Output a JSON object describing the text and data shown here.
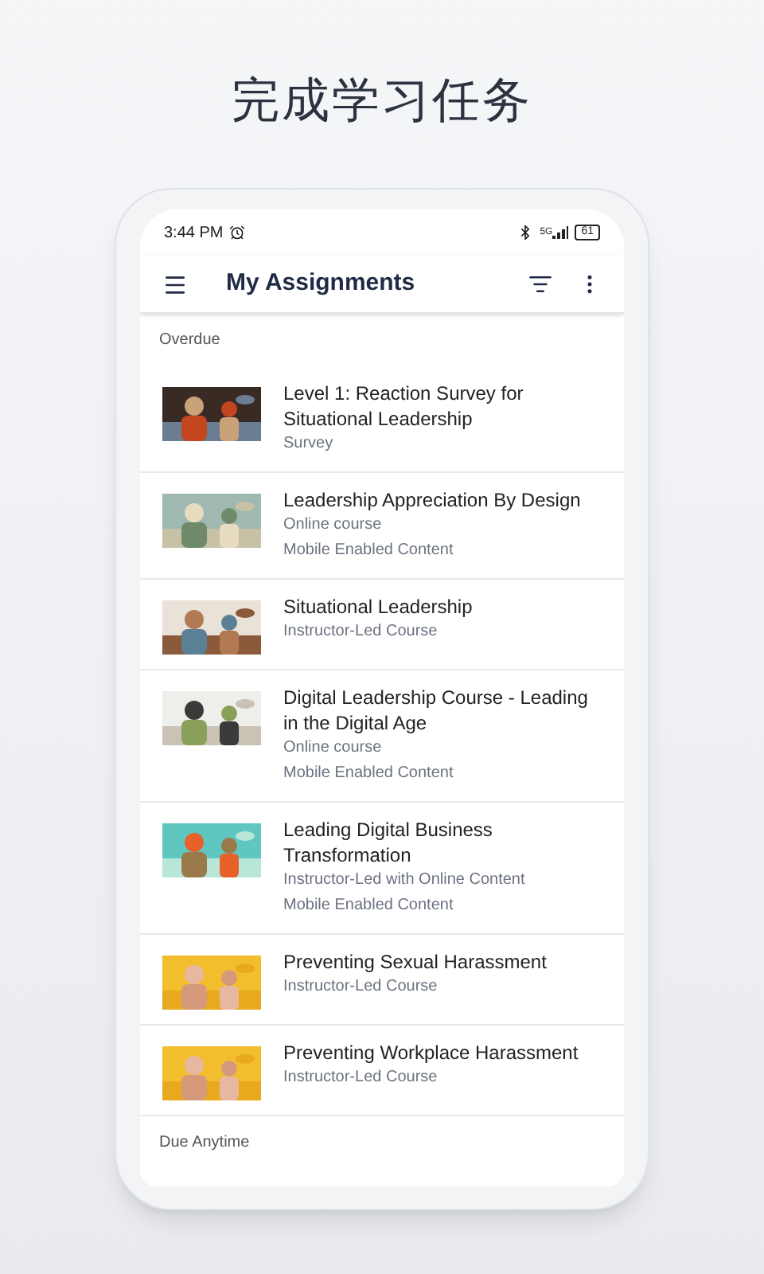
{
  "headline": "完成学习任务",
  "status_bar": {
    "time": "3:44 PM",
    "network": "5G",
    "battery": "61"
  },
  "app_bar": {
    "title": "My Assignments"
  },
  "sections": [
    {
      "title": "Overdue",
      "items": [
        {
          "title": "Level 1: Reaction Survey for Situational Leadership",
          "details": [
            "Survey"
          ]
        },
        {
          "title": "Leadership Appreciation By Design",
          "details": [
            "Online course",
            "Mobile Enabled Content"
          ]
        },
        {
          "title": "Situational Leadership",
          "details": [
            "Instructor-Led Course"
          ]
        },
        {
          "title": "Digital Leadership Course - Leading in the Digital Age",
          "details": [
            "Online course",
            "Mobile Enabled Content"
          ]
        },
        {
          "title": "Leading Digital Business Transformation",
          "details": [
            "Instructor-Led with Online Content",
            "Mobile Enabled Content"
          ]
        },
        {
          "title": "Preventing Sexual Harassment",
          "details": [
            "Instructor-Led Course"
          ]
        },
        {
          "title": "Preventing Workplace Harassment",
          "details": [
            "Instructor-Led Course"
          ]
        }
      ]
    },
    {
      "title": "Due Anytime"
    }
  ]
}
